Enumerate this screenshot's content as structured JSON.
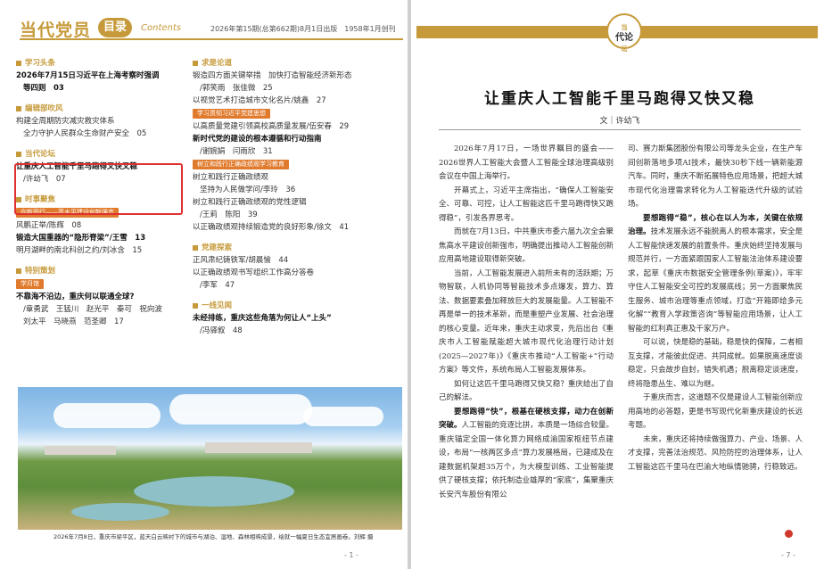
{
  "left": {
    "brand": "当代党员",
    "badge": "目录",
    "en": "Contents",
    "issue": "2026年第15期(总第662期)8月1日出版　1958年1月创刊",
    "col_a": [
      {
        "t": "head",
        "text": "学习头条"
      },
      {
        "t": "item",
        "text": "2026年7月15日习近平在上海考察时强调",
        "b": true
      },
      {
        "t": "item",
        "text": "等四则　03",
        "b": true,
        "indent": true
      },
      {
        "t": "gap"
      },
      {
        "t": "head",
        "text": "编辑部吹风"
      },
      {
        "t": "item",
        "text": "构建全周期防灾减灾救灾体系"
      },
      {
        "t": "item",
        "text": "全力守护人民群众生命财产安全　05",
        "indent": true
      },
      {
        "t": "gap"
      },
      {
        "t": "head",
        "text": "当代论坛"
      },
      {
        "t": "item",
        "text": "让重庆人工智能千里马跑得又快又稳",
        "b": true
      },
      {
        "t": "item",
        "text": "/许幼飞　07",
        "indent": true
      },
      {
        "t": "gap"
      },
      {
        "t": "head",
        "text": "时事聚焦"
      },
      {
        "t": "tag",
        "text": "向新而行——高水平建设创新强市"
      },
      {
        "t": "item",
        "text": "风鹏正举/陈辉　08"
      },
      {
        "t": "item",
        "text": "锻造大国重器的“隐形脊梁”/王雪　13",
        "b": true
      },
      {
        "t": "item",
        "text": "明月湖畔的南北科创之约/刘冰含　15"
      },
      {
        "t": "gap"
      },
      {
        "t": "head",
        "text": "特别策划"
      },
      {
        "t": "tag",
        "text": "学月馆"
      },
      {
        "t": "item",
        "text": "不靠海不沿边，重庆何以联通全球?",
        "b": true
      },
      {
        "t": "item",
        "text": "/章勇武　王猛川　赵光平　秦可　祝向波",
        "indent": true
      },
      {
        "t": "item",
        "text": "刘太平　马晓燕　范圣卿　17",
        "indent": true
      }
    ],
    "col_b": [
      {
        "t": "head",
        "text": "求是论道"
      },
      {
        "t": "item",
        "text": "锻造四方面关键举措　加快打造智能经济新形态"
      },
      {
        "t": "item",
        "text": "/郭笑雨　张佳微　25",
        "indent": true
      },
      {
        "t": "item",
        "text": "以视觉艺术打造城市文化名片/姚鑫　27"
      },
      {
        "t": "tag",
        "text": "学习贯彻习近平党建思想"
      },
      {
        "t": "item",
        "text": "以高质量党建引领高校高质量发展/伍安春　29"
      },
      {
        "t": "item",
        "text": "新时代党的建设的根本遵循和行动指南",
        "b": true
      },
      {
        "t": "item",
        "text": "/谢婉娟　闫雨欣　31",
        "indent": true
      },
      {
        "t": "tag",
        "text": "树立和践行正确政绩观学习教育"
      },
      {
        "t": "item",
        "text": "树立和践行正确政绩观"
      },
      {
        "t": "item",
        "text": "坚持为人民做学问/李玲　36",
        "indent": true
      },
      {
        "t": "item",
        "text": "树立和践行正确政绩观的党性逻辑"
      },
      {
        "t": "item",
        "text": "/王莉　陈阳　39",
        "indent": true
      },
      {
        "t": "item",
        "text": "以正确政绩观持续锻造党的良好形象/徐文　41"
      },
      {
        "t": "gap"
      },
      {
        "t": "head",
        "text": "党建探索"
      },
      {
        "t": "item",
        "text": "正风肃纪铸铁军/胡晨愉　44"
      },
      {
        "t": "item",
        "text": "以正确政绩观书写组织工作高分答卷"
      },
      {
        "t": "item",
        "text": "/李军　47",
        "indent": true
      },
      {
        "t": "gap"
      },
      {
        "t": "head",
        "text": "一线见闻"
      },
      {
        "t": "item",
        "text": "未经排练，重庆这些角落为何让人“上头”",
        "b": true
      },
      {
        "t": "item",
        "text": "/冯驿叙　48",
        "indent": true
      }
    ],
    "caption": "2026年7月8日，重庆市梁平区，蓝天白云映衬下的城市与湖泊、湿地、森林相映成景，绘就一幅夏日生态宜居画卷。刘辉 摄",
    "page_no": "- 1 -"
  },
  "right": {
    "logo_top": "当",
    "logo_mid": "代论",
    "logo_bottom": "坛",
    "title": "让重庆人工智能千里马跑得又快又稳",
    "byline": "文｜许幼飞",
    "col_a": [
      {
        "text": "2026年7月17日，一场世界瞩目的盛会——2026世界人工智能大会暨人工智能全球治理高级别会议在中国上海举行。"
      },
      {
        "text": "开幕式上，习近平主席指出，“确保人工智能安全、可靠、可控，让人工智能这匹千里马跑得快又跑得稳”，引发各界思考。"
      },
      {
        "text": "而就在7月13日，中共重庆市委六届九次全会聚焦高水平建设创新强市，明确提出推动人工智能创新应用高地建设取得新突破。"
      },
      {
        "text": "当前，人工智能发展进入前所未有的活跃期；万物智联，人机协同等智能技术多点爆发，算力、算法、数据要素叠加释放巨大的发展能量。人工智能不再是单一的技术革新，而是重塑产业发展、社会治理的核心变量。近年来，重庆主动求变，先后出台《重庆市人工智能赋能超大城市现代化治理行动计划(2025—2027年)》《重庆市推动“人工智能+”行动方案》等文件，系统布局人工智能发展体系。"
      },
      {
        "text": "如何让这匹千里马跑得又快又稳？重庆给出了自己的解法。"
      },
      {
        "lead": "要想跑得“快”，根基在硬核支撑，动力在创新突破。",
        "text": "人工智能的竞逐比拼，本质是一场综合较量。重庆锚定全国一体化算力网络成渝国家枢纽节点建设，布局“一核两区多点”算力发展格局，已建成及在建数据机架超35万个，为大模型训练、工业智能提供了硬核支撑；依托制造业雄厚的“家底”，集聚重庆长安汽车股份有限公"
      }
    ],
    "col_b": [
      {
        "lead_plain": true,
        "text": "司、赛力斯集团股份有限公司等龙头企业，在生产车间创新落地多项AI技术，最快30秒下线一辆新能源汽车。同时，重庆不断拓展特色应用场景，把超大城市现代化治理需求转化为人工智能迭代升级的试验场。"
      },
      {
        "lead": "要想跑得“稳”，核心在以人为本，关键在依规治理。",
        "text": "技术发展永远不能脱离人的根本需求，安全是人工智能快速发展的前置条件。重庆始终坚持发展与规范并行，一方面紧跟国家人工智能法治体系建设要求，起草《重庆市数据安全管理条例(草案)》，牢牢守住人工智能安全可控的发展底线；另一方面聚焦民生服务、城市治理等重点领域，打造“开箱即给多元化解”“教育入学政策咨询”等智能应用场景，让人工智能的红利真正惠及千家万户。"
      },
      {
        "text": "可以说，快是稳的基础，稳是快的保障，二者相互支撑，才能彼此促进、共同成就。如果脱离速度谈稳定，只会故步自封，错失机遇；脱离稳定谈速度，终将隐患丛生、难以为继。"
      },
      {
        "text": "于重庆而言，这道题不仅是建设人工智能创新应用高地的必答题，更是书写现代化新重庆建设的长远考题。"
      },
      {
        "text": "未来，重庆还将持续做强算力、产业、场景、人才支撑，完善法治规范、风险防控的治理体系，让人工智能这匹千里马在巴渝大地纵情驰骋，行稳致远。"
      }
    ],
    "page_no": "- 7 -"
  }
}
